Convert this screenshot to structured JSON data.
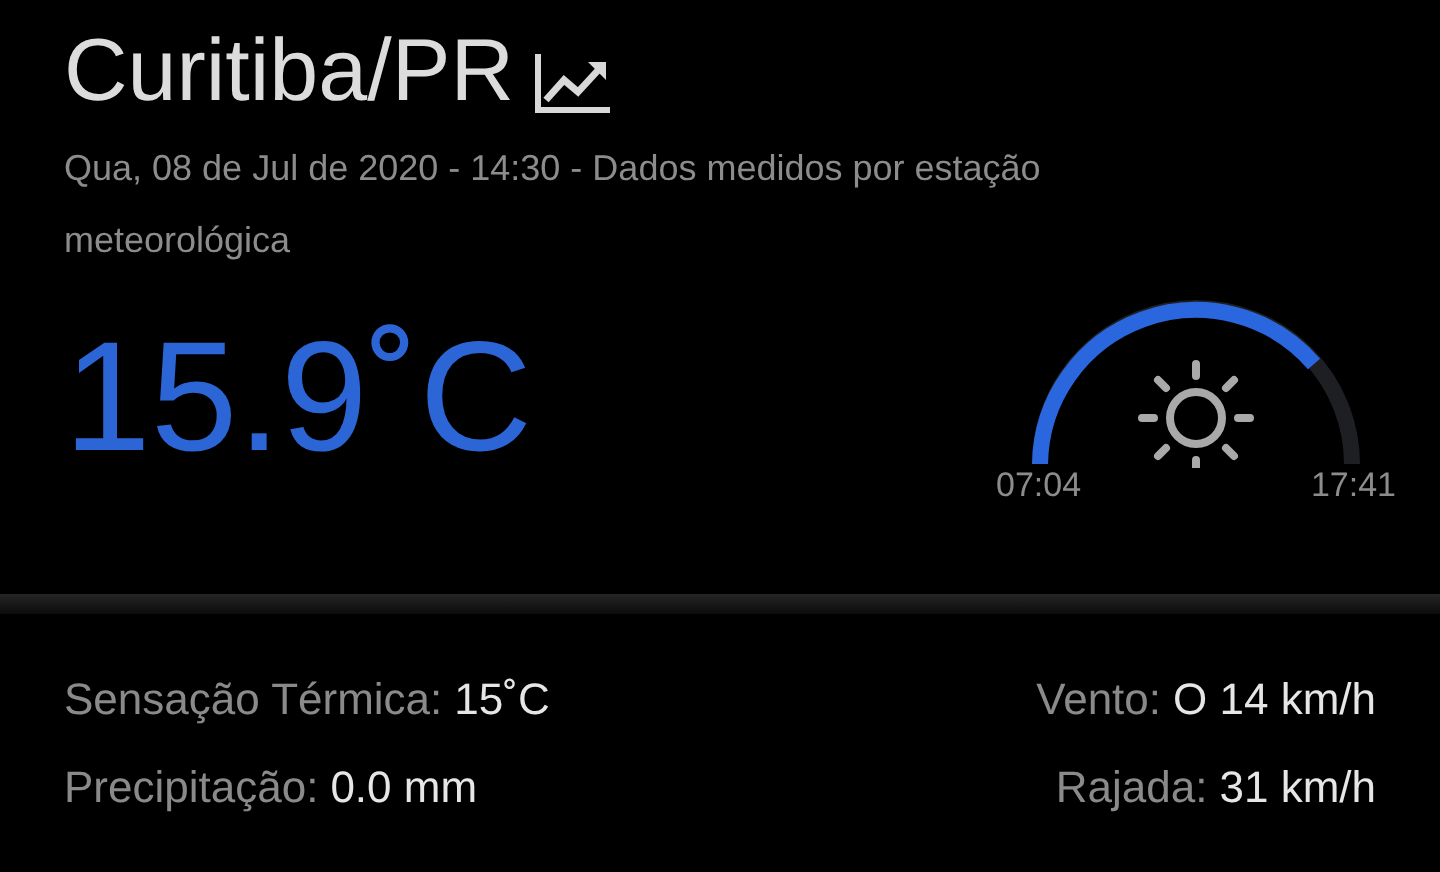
{
  "location": {
    "title": "Curitiba/PR"
  },
  "subtitle": "Qua, 08 de Jul de 2020 - 14:30 - Dados medidos por estação meteorológica",
  "temperature": "15.9˚C",
  "sun": {
    "sunrise": "07:04",
    "sunset": "17:41"
  },
  "details_left": [
    {
      "label": "Sensação Térmica:",
      "value": "15˚C"
    },
    {
      "label": "Precipitação:",
      "value": "0.0 mm"
    }
  ],
  "details_right": [
    {
      "label": "Vento:",
      "value": "O 14 km/h"
    },
    {
      "label": "Rajada:",
      "value": "31 km/h"
    }
  ]
}
